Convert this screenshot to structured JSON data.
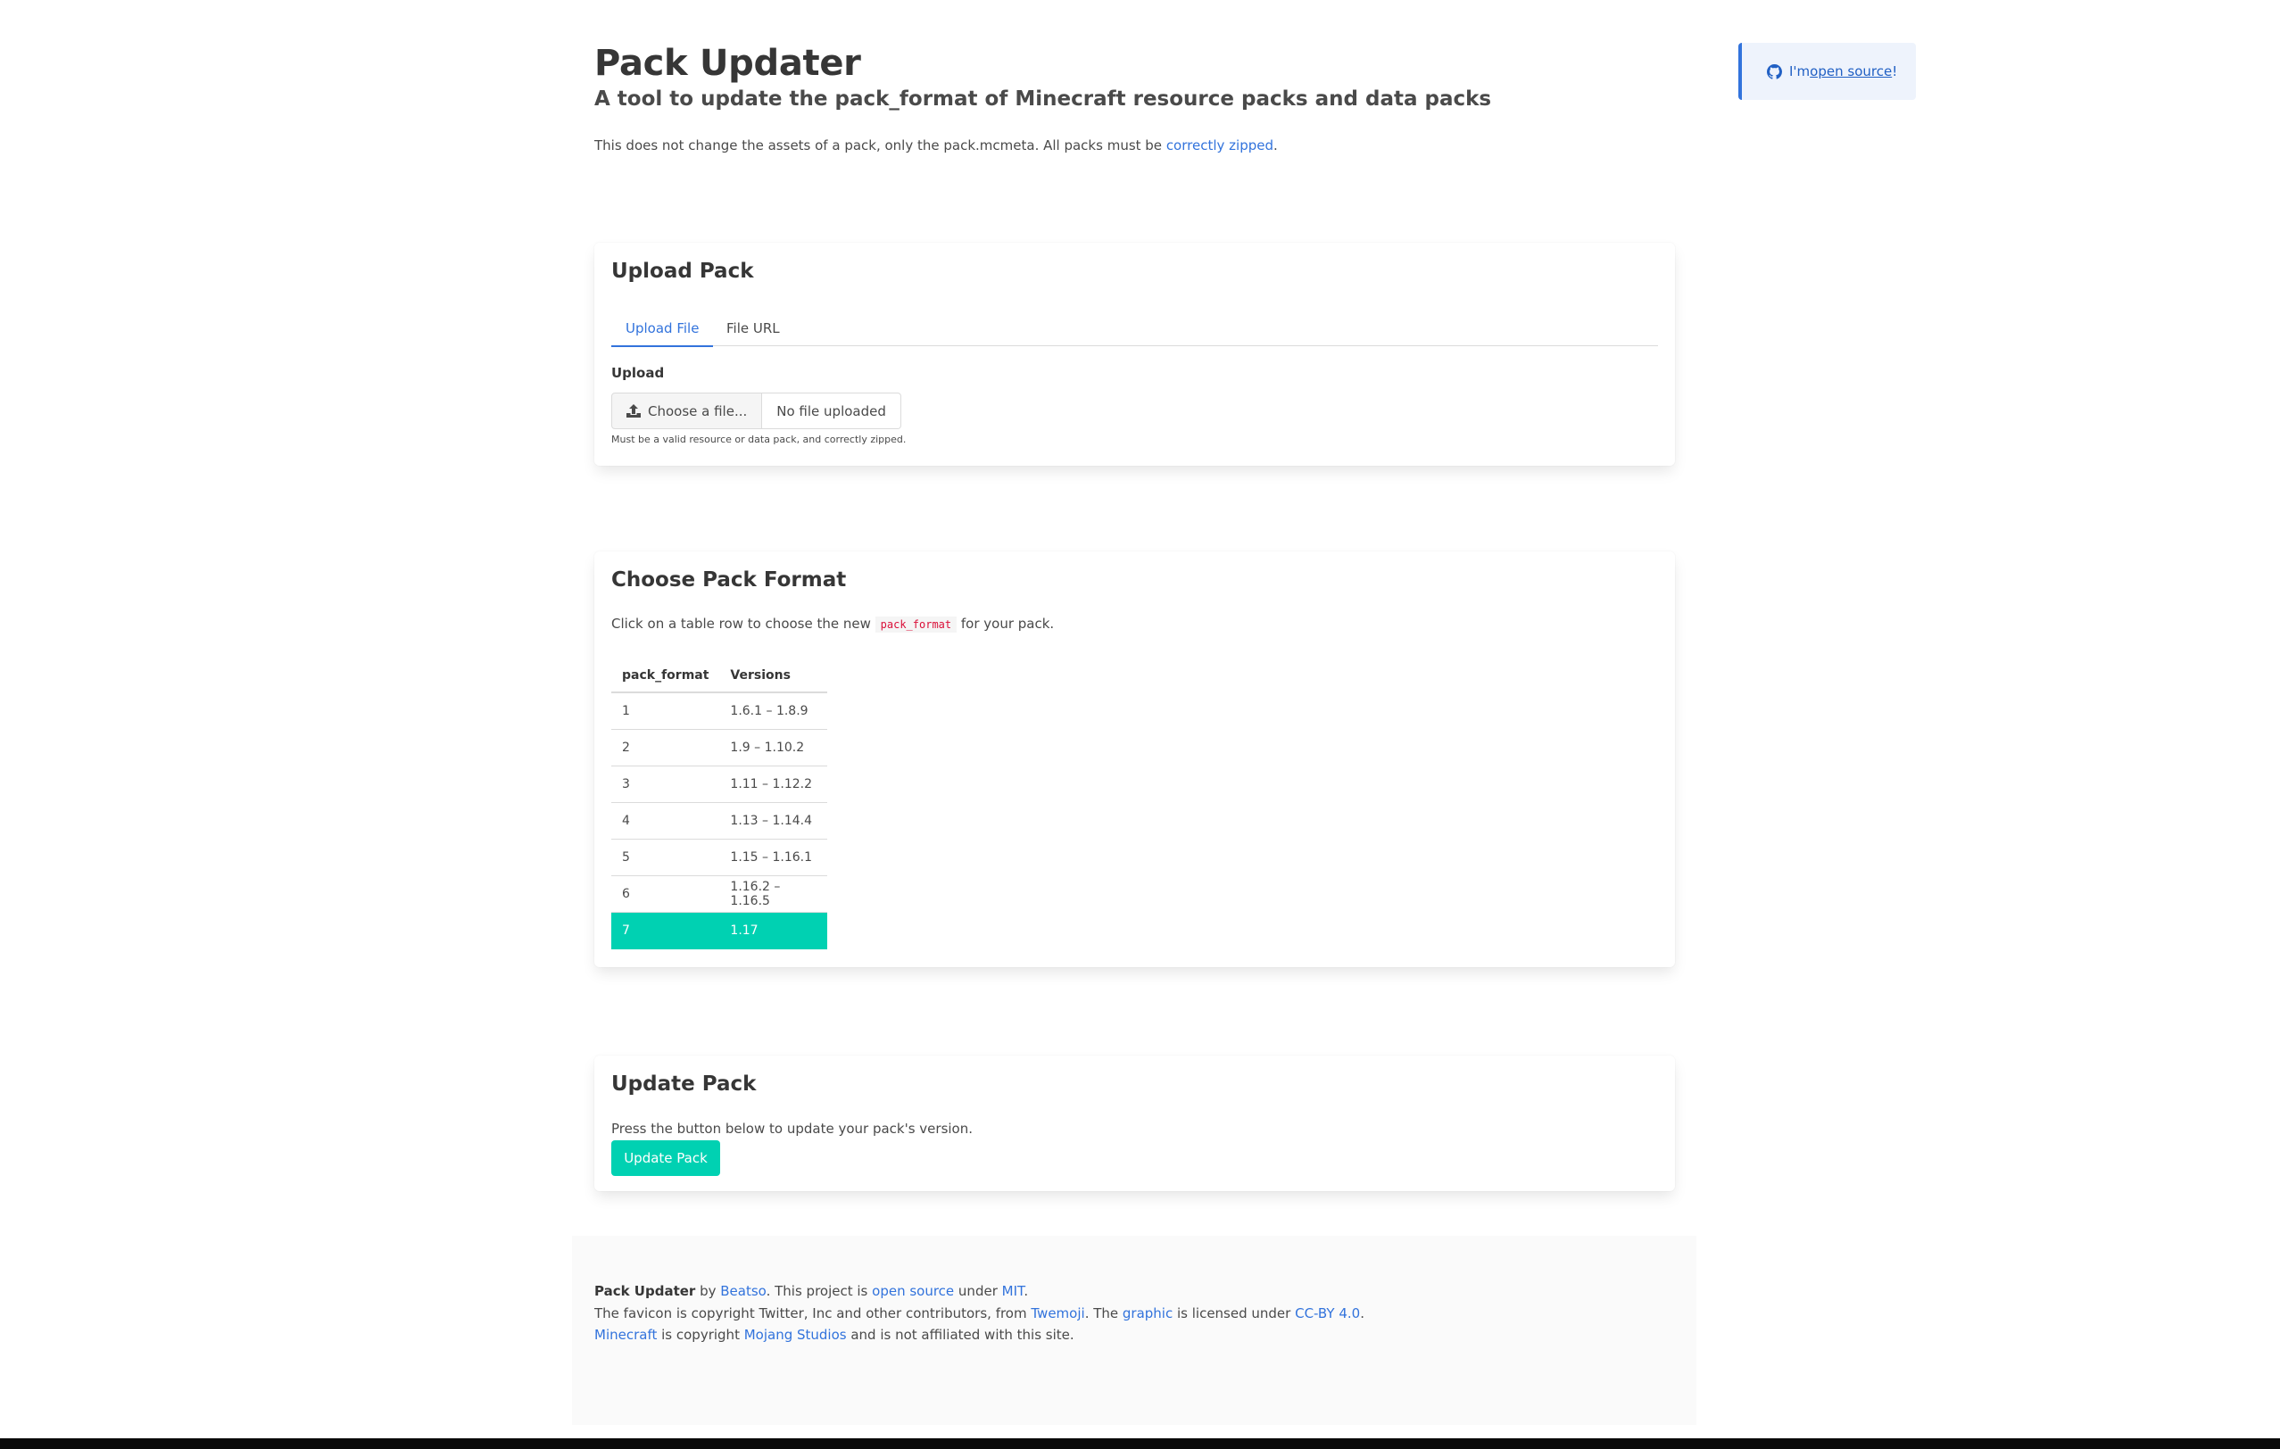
{
  "header": {
    "title": "Pack Updater",
    "subtitle": "A tool to update the pack_format of Minecraft resource packs and data packs",
    "note_prefix": "This does not change the assets of a pack, only the pack.mcmeta. All packs must be ",
    "note_link": "correctly zipped",
    "note_suffix": "."
  },
  "github_notice": {
    "prefix": "I'm ",
    "link": "open source",
    "suffix": "!",
    "icon": "github-icon"
  },
  "upload": {
    "title": "Upload Pack",
    "tabs": [
      {
        "label": "Upload File",
        "active": true
      },
      {
        "label": "File URL",
        "active": false
      }
    ],
    "field_label": "Upload",
    "choose_label": "Choose a file...",
    "choose_icon": "upload-icon",
    "file_name": "No file uploaded",
    "help": "Must be a valid resource or data pack, and correctly zipped."
  },
  "format": {
    "title": "Choose Pack Format",
    "desc_prefix": "Click on a table row to choose the new ",
    "desc_code": "pack_format",
    "desc_suffix": " for your pack.",
    "columns": [
      "pack_format",
      "Versions"
    ],
    "rows": [
      {
        "format": "1",
        "versions": "1.6.1 – 1.8.9"
      },
      {
        "format": "2",
        "versions": "1.9 – 1.10.2"
      },
      {
        "format": "3",
        "versions": "1.11 – 1.12.2"
      },
      {
        "format": "4",
        "versions": "1.13 – 1.14.4"
      },
      {
        "format": "5",
        "versions": "1.15 – 1.16.1"
      },
      {
        "format": "6",
        "versions": "1.16.2 – 1.16.5"
      },
      {
        "format": "7",
        "versions": "1.17"
      }
    ],
    "selected_format": "7",
    "selected_color": "#00d1b2"
  },
  "update": {
    "title": "Update Pack",
    "desc": "Press the button below to update your pack's version.",
    "button_label": "Update Pack"
  },
  "footer": {
    "line1": {
      "bold": "Pack Updater",
      "t1": " by ",
      "l1": "Beatso",
      "t2": ". This project is ",
      "l2": "open source",
      "t3": " under ",
      "l3": "MIT",
      "t4": "."
    },
    "line2": {
      "t1": "The favicon is copyright Twitter, Inc and other contributors, from ",
      "l1": "Twemoji",
      "t2": ". The ",
      "l2": "graphic",
      "t3": " is licensed under ",
      "l3": "CC-BY 4.0",
      "t4": "."
    },
    "line3": {
      "l1": "Minecraft",
      "t1": " is copyright ",
      "l2": "Mojang Studios",
      "t2": " and is not affiliated with this site."
    }
  },
  "colors": {
    "link": "#3273dc",
    "primary": "#00d1b2",
    "code": "#da1039"
  }
}
